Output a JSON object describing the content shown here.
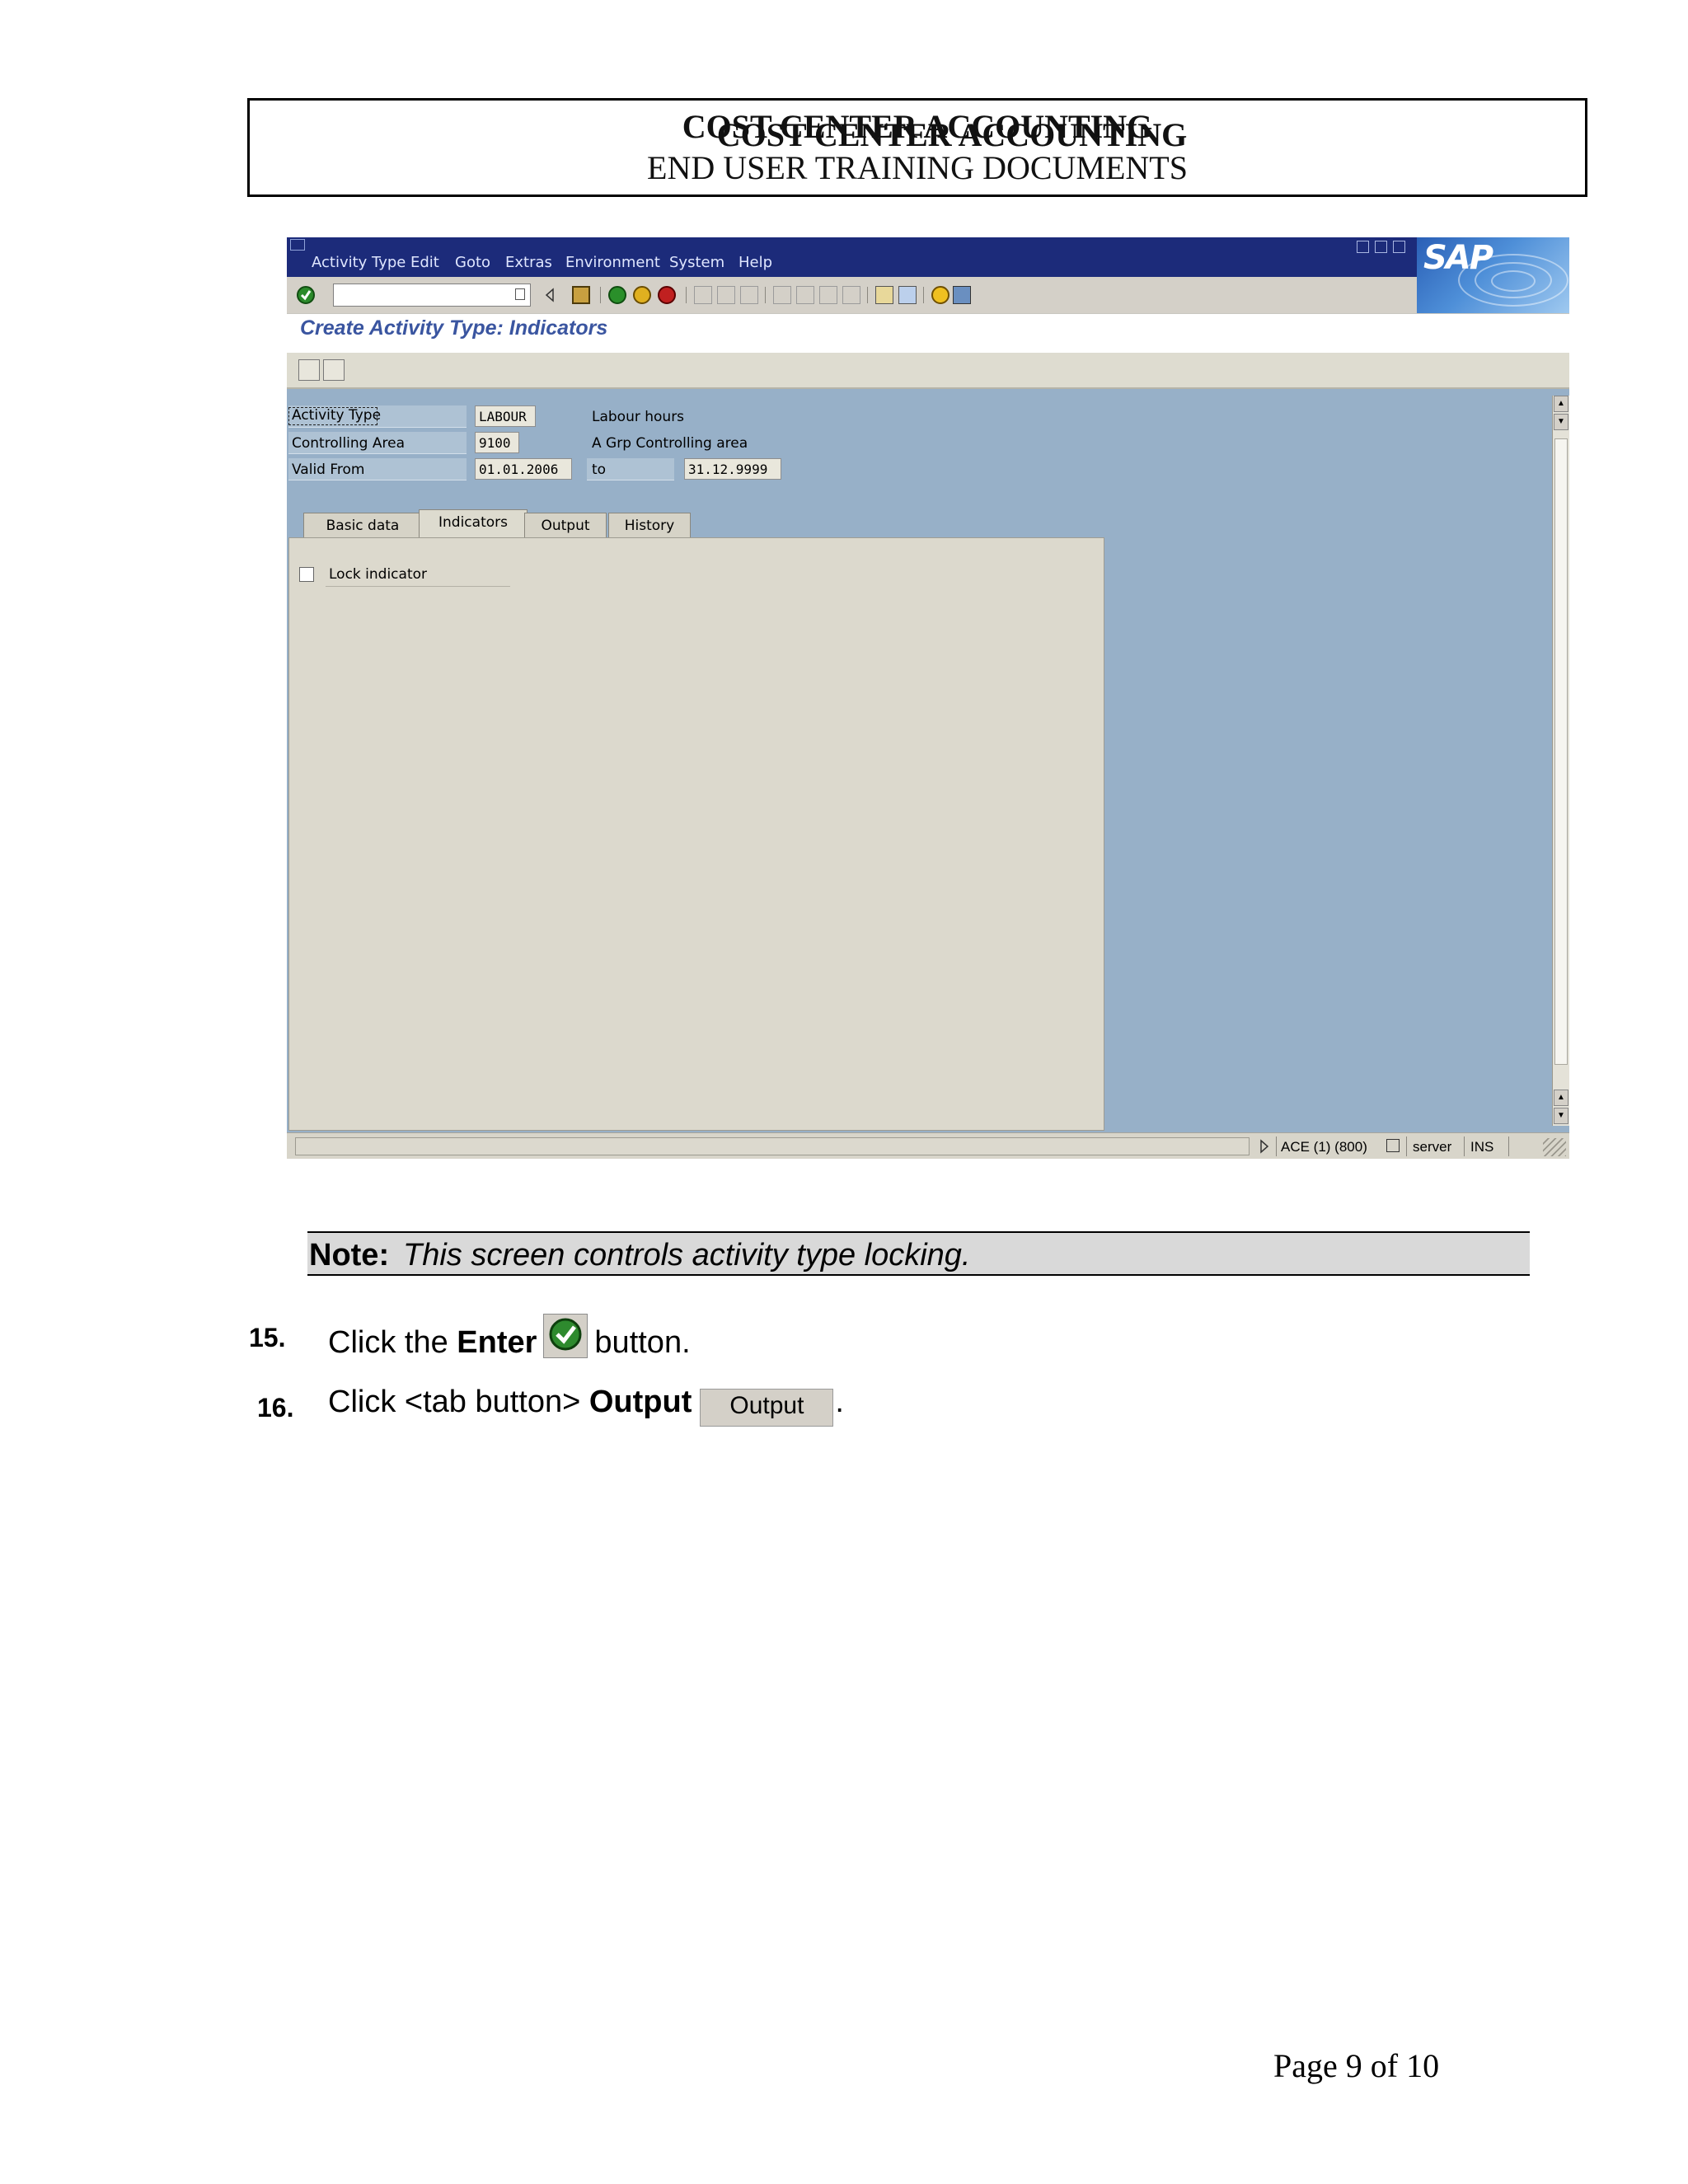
{
  "header": {
    "title": "COST CENTER ACCOUNTING",
    "subtitle": "END USER TRAINING DOCUMENTS"
  },
  "sap_window": {
    "menu": [
      "Activity Type",
      "Edit",
      "Goto",
      "Extras",
      "Environment",
      "System",
      "Help"
    ],
    "logo": "SAP",
    "command_field_value": "",
    "screen_title": "Create Activity Type: Indicators",
    "fields": {
      "activity_type": {
        "label": "Activity Type",
        "value": "LABOUR",
        "description": "Labour hours"
      },
      "controlling_area": {
        "label": "Controlling Area",
        "value": "9100",
        "description": "A Grp Controlling area"
      },
      "valid_from": {
        "label": "Valid From",
        "value": "01.01.2006",
        "to_label": "to",
        "to_value": "31.12.9999"
      }
    },
    "tabs": [
      "Basic data",
      "Indicators",
      "Output",
      "History"
    ],
    "active_tab": "Indicators",
    "lock_indicator": {
      "label": "Lock indicator",
      "checked": false
    },
    "status_bar": {
      "system": "ACE (1) (800)",
      "server": "server",
      "mode": "INS"
    },
    "colors": {
      "menubar": "#1c2b7a",
      "background": "#97b0c8",
      "panel": "#dcd9cd",
      "title": "#3a55a0"
    },
    "icons": [
      "enter-icon",
      "save-icon",
      "back-icon",
      "exit-icon",
      "cancel-icon",
      "print-icon",
      "find-icon",
      "help-icon"
    ]
  },
  "note": {
    "label": "Note:",
    "text": "This screen controls activity type locking."
  },
  "steps": [
    {
      "number": "15.",
      "prefix": "Click the",
      "bold": "Enter",
      "suffix": "button."
    },
    {
      "number": "16.",
      "prefix": "Click <tab button>",
      "bold": "Output",
      "button_label": "Output",
      "suffix": "."
    }
  ],
  "footer": {
    "page": "Page 9 of 10"
  }
}
